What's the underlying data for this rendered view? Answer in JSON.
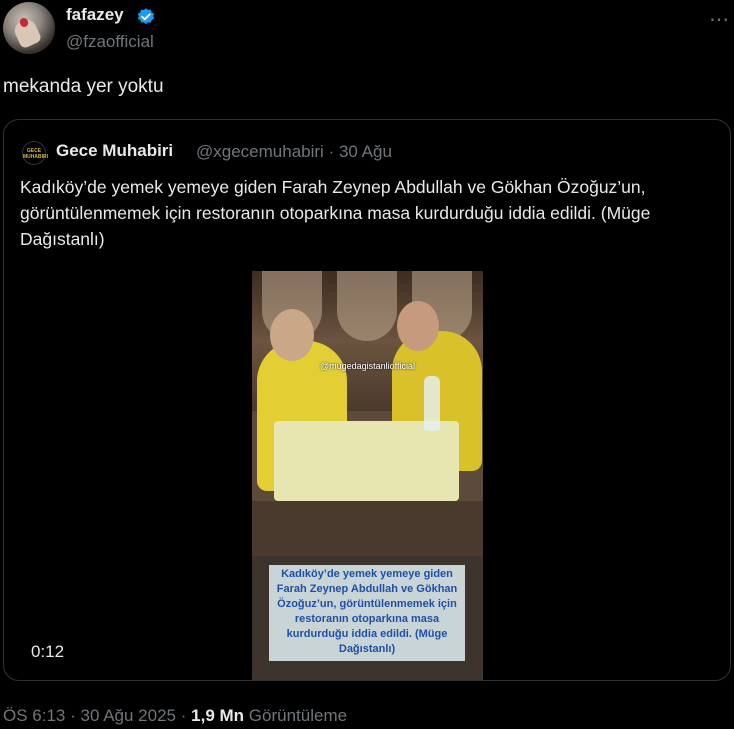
{
  "author": {
    "name": "fafazey",
    "handle": "@fzaofficial",
    "verified_icon": "verified-badge-icon",
    "verified_color": "#1d9bf0"
  },
  "more_icon": "⋯",
  "tweet": {
    "text": "mekanda yer yoktu"
  },
  "quoted": {
    "avatar_label": "GECE MUHABIRI",
    "name": "Gece Muhabiri",
    "handle": "@xgecemuhabiri",
    "separator": "·",
    "date": "30 Ağu",
    "text": "Kadıköy’de yemek yemeye giden Farah Zeynep Abdullah ve Gökhan Özoğuz’un, görüntülenmemek için restoranın otoparkına masa kurdurduğu iddia edildi. (Müge Dağıstanlı)",
    "media": {
      "watermark": "@mugedagistanliofficial",
      "caption": "Kadıköy’de yemek yemeye giden Farah Zeynep Abdullah ve Gökhan Özoğuz’un, görüntülenmemek için restoranın otoparkına masa kurdurduğu iddia edildi. (Müge Dağıstanlı)",
      "duration": "0:12"
    }
  },
  "footer": {
    "time": "ÖS 6:13",
    "sep1": "·",
    "date": "30 Ağu 2025",
    "sep2": "·",
    "views": "1,9 Mn",
    "views_label": "Görüntüleme"
  }
}
